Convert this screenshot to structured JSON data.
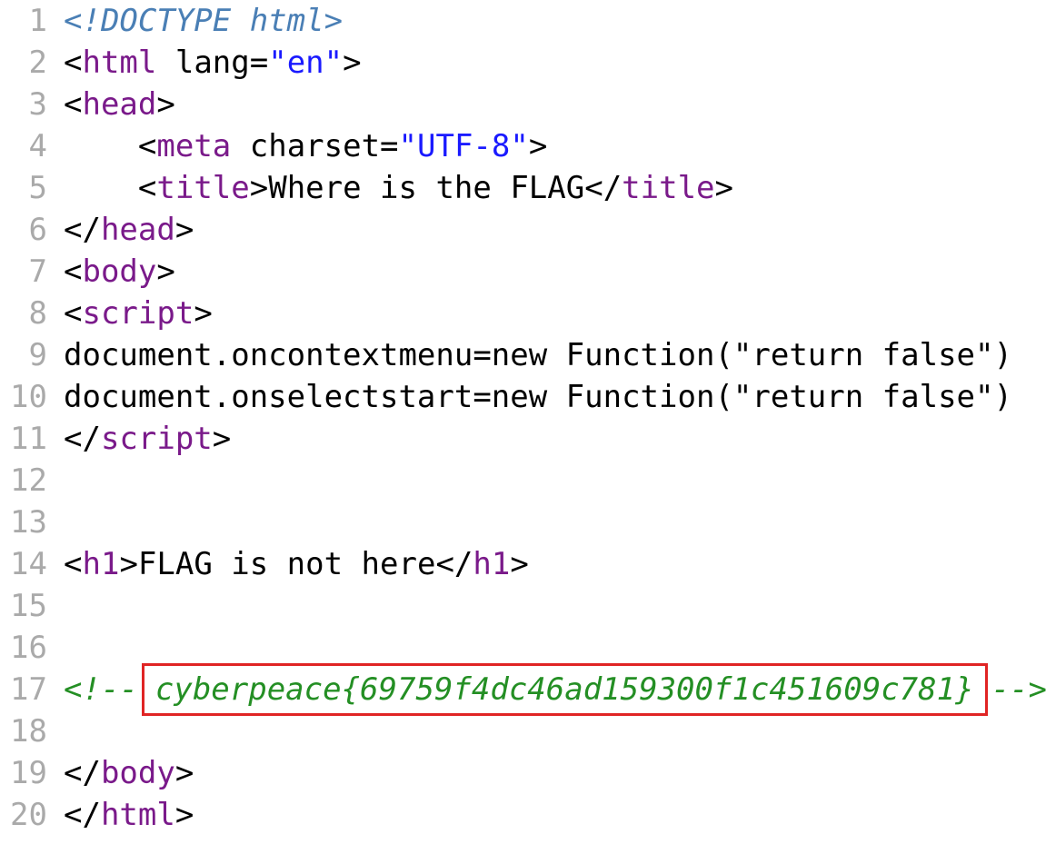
{
  "lines": [
    {
      "n": "1",
      "doctype": "<!DOCTYPE html>"
    },
    {
      "n": "2",
      "open": "<",
      "tag": "html",
      "sp": " ",
      "attr": "lang=",
      "q1": "\"",
      "val": "en",
      "q2": "\"",
      "close": ">"
    },
    {
      "n": "3",
      "open": "<",
      "tag": "head",
      "close": ">"
    },
    {
      "n": "4",
      "indent": "    ",
      "open": "<",
      "tag": "meta",
      "sp": " ",
      "attr": "charset=",
      "q1": "\"",
      "val": "UTF-8",
      "q2": "\"",
      "close": ">"
    },
    {
      "n": "5",
      "indent": "    ",
      "open": "<",
      "tag": "title",
      "close": ">",
      "text": "Where is the FLAG",
      "open2": "</",
      "tag2": "title",
      "close2": ">"
    },
    {
      "n": "6",
      "open": "</",
      "tag": "head",
      "close": ">"
    },
    {
      "n": "7",
      "open": "<",
      "tag": "body",
      "close": ">"
    },
    {
      "n": "8",
      "open": "<",
      "tag": "script",
      "close": ">"
    },
    {
      "n": "9",
      "text": "document.oncontextmenu=new Function(\"return false\")"
    },
    {
      "n": "10",
      "text": "document.onselectstart=new Function(\"return false\")"
    },
    {
      "n": "11",
      "open": "</",
      "tag": "script",
      "close": ">"
    },
    {
      "n": "12"
    },
    {
      "n": "13"
    },
    {
      "n": "14",
      "open": "<",
      "tag": "h1",
      "close": ">",
      "text": "FLAG is not here",
      "open2": "</",
      "tag2": "h1",
      "close2": ">"
    },
    {
      "n": "15"
    },
    {
      "n": "16"
    },
    {
      "n": "17",
      "comment_open": "<!--",
      "flag": "cyberpeace{69759f4dc46ad159300f1c451609c781}",
      "comment_close": "-->"
    },
    {
      "n": "18"
    },
    {
      "n": "19",
      "open": "</",
      "tag": "body",
      "close": ">"
    },
    {
      "n": "20",
      "open": "</",
      "tag": "html",
      "close": ">"
    }
  ],
  "colors": {
    "tag": "#7a1a8a",
    "value": "#1a1aff",
    "doctype": "#4a7fb5",
    "comment": "#248f24",
    "line_number": "#aaaaaa",
    "highlight_box": "#e02424"
  }
}
